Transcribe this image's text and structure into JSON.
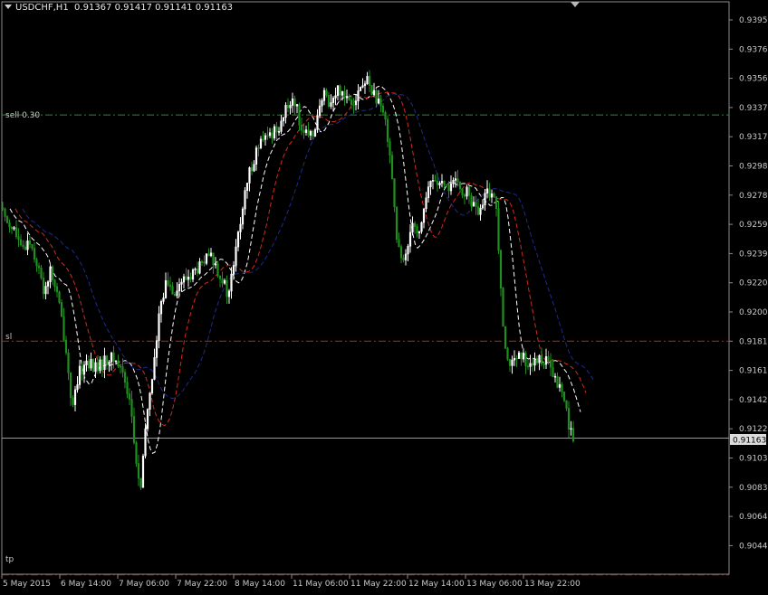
{
  "header": {
    "symbol_tf": "USDCHF,H1",
    "open": "0.91367",
    "high": "0.91417",
    "low": "0.91141",
    "close": "0.91163"
  },
  "levels": {
    "sell_label": "sell 0.30",
    "sl_label": "sl",
    "tp_label": "tp",
    "current_price_label": "0.91163"
  },
  "colors": {
    "background": "#000000",
    "bull_candle": "#ffffff",
    "bear_candle": "#1f8f1f",
    "ma_fast": "#ffffff",
    "ma_mid": "#d42a1c",
    "ma_slow": "#1c2c8c",
    "sell_line": "#2f8a2f",
    "sl_line": "#b02a1a",
    "tp_line": "#b02a1a",
    "price_line": "#9a9a9a",
    "axis": "#8c8c8c",
    "text": "#c8c8c8"
  },
  "chart_data": {
    "type": "candlestick",
    "symbol": "USDCHF",
    "timeframe": "H1",
    "y_ticks": [
      "0.93955",
      "0.93760",
      "0.93565",
      "0.93370",
      "0.93175",
      "0.92980",
      "0.92785",
      "0.92590",
      "0.92395",
      "0.92200",
      "0.92005",
      "0.91810",
      "0.91615",
      "0.91420",
      "0.91225",
      "0.91030",
      "0.90835",
      "0.90640",
      "0.90445"
    ],
    "x_ticks": [
      "5 May 2015",
      "6 May 14:00",
      "7 May 06:00",
      "7 May 22:00",
      "8 May 14:00",
      "11 May 06:00",
      "11 May 22:00",
      "12 May 14:00",
      "13 May 06:00",
      "13 May 22:00"
    ],
    "ylim": [
      0.9025,
      0.9415
    ],
    "levels": {
      "sell": 0.9332,
      "sl": 0.9181,
      "tp": 0.9025,
      "current": 0.91163
    },
    "close_path": [
      [
        0,
        0.927
      ],
      [
        8,
        0.9262
      ],
      [
        16,
        0.9255
      ],
      [
        24,
        0.924
      ],
      [
        32,
        0.925
      ],
      [
        40,
        0.9235
      ],
      [
        48,
        0.9215
      ],
      [
        56,
        0.9228
      ],
      [
        64,
        0.921
      ],
      [
        72,
        0.918
      ],
      [
        80,
        0.9135
      ],
      [
        88,
        0.916
      ],
      [
        96,
        0.9168
      ],
      [
        104,
        0.9163
      ],
      [
        112,
        0.9165
      ],
      [
        120,
        0.917
      ],
      [
        128,
        0.9168
      ],
      [
        136,
        0.916
      ],
      [
        144,
        0.914
      ],
      [
        150,
        0.91
      ],
      [
        156,
        0.908
      ],
      [
        160,
        0.912
      ],
      [
        166,
        0.915
      ],
      [
        172,
        0.9175
      ],
      [
        178,
        0.921
      ],
      [
        184,
        0.922
      ],
      [
        192,
        0.9215
      ],
      [
        200,
        0.922
      ],
      [
        210,
        0.9225
      ],
      [
        220,
        0.923
      ],
      [
        232,
        0.9238
      ],
      [
        244,
        0.9225
      ],
      [
        252,
        0.921
      ],
      [
        260,
        0.924
      ],
      [
        268,
        0.927
      ],
      [
        276,
        0.9295
      ],
      [
        284,
        0.931
      ],
      [
        292,
        0.9315
      ],
      [
        300,
        0.932
      ],
      [
        308,
        0.9325
      ],
      [
        316,
        0.9335
      ],
      [
        324,
        0.9345
      ],
      [
        330,
        0.933
      ],
      [
        336,
        0.932
      ],
      [
        342,
        0.9315
      ],
      [
        350,
        0.933
      ],
      [
        358,
        0.9345
      ],
      [
        366,
        0.934
      ],
      [
        374,
        0.935
      ],
      [
        382,
        0.9345
      ],
      [
        390,
        0.9342
      ],
      [
        398,
        0.935
      ],
      [
        406,
        0.9355
      ],
      [
        414,
        0.9345
      ],
      [
        420,
        0.9335
      ],
      [
        426,
        0.9328
      ],
      [
        432,
        0.93
      ],
      [
        438,
        0.925
      ],
      [
        444,
        0.923
      ],
      [
        450,
        0.9245
      ],
      [
        456,
        0.9265
      ],
      [
        462,
        0.925
      ],
      [
        468,
        0.927
      ],
      [
        474,
        0.9285
      ],
      [
        480,
        0.929
      ],
      [
        486,
        0.9285
      ],
      [
        492,
        0.9282
      ],
      [
        500,
        0.9288
      ],
      [
        508,
        0.9282
      ],
      [
        516,
        0.928
      ],
      [
        524,
        0.927
      ],
      [
        530,
        0.9265
      ],
      [
        536,
        0.9278
      ],
      [
        542,
        0.9282
      ],
      [
        548,
        0.927
      ],
      [
        552,
        0.923
      ],
      [
        556,
        0.919
      ],
      [
        560,
        0.917
      ],
      [
        566,
        0.9165
      ],
      [
        574,
        0.917
      ],
      [
        582,
        0.9168
      ],
      [
        590,
        0.9165
      ],
      [
        598,
        0.917
      ],
      [
        606,
        0.9165
      ],
      [
        612,
        0.9155
      ],
      [
        618,
        0.915
      ],
      [
        624,
        0.914
      ],
      [
        630,
        0.912
      ],
      [
        634,
        0.9116
      ]
    ]
  }
}
